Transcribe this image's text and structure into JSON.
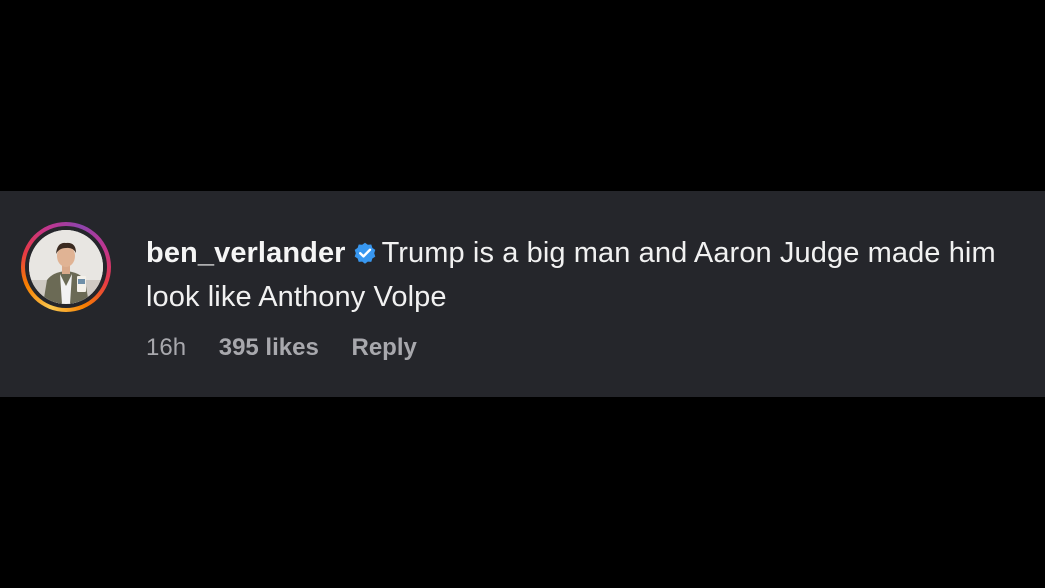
{
  "comment": {
    "username": "ben_verlander",
    "verified": true,
    "text": "Trump is a big man and Aaron Judge made him look like Anthony Volpe",
    "timestamp": "16h",
    "likes": "395 likes",
    "reply_label": "Reply",
    "avatar_icon": "profile-photo",
    "verified_icon": "verified-badge-icon"
  },
  "colors": {
    "page_background": "#000000",
    "card_background": "#25262b",
    "primary_text": "#f1f1f1",
    "secondary_text": "#a8a8ad",
    "verified_blue": "#3897f0"
  }
}
